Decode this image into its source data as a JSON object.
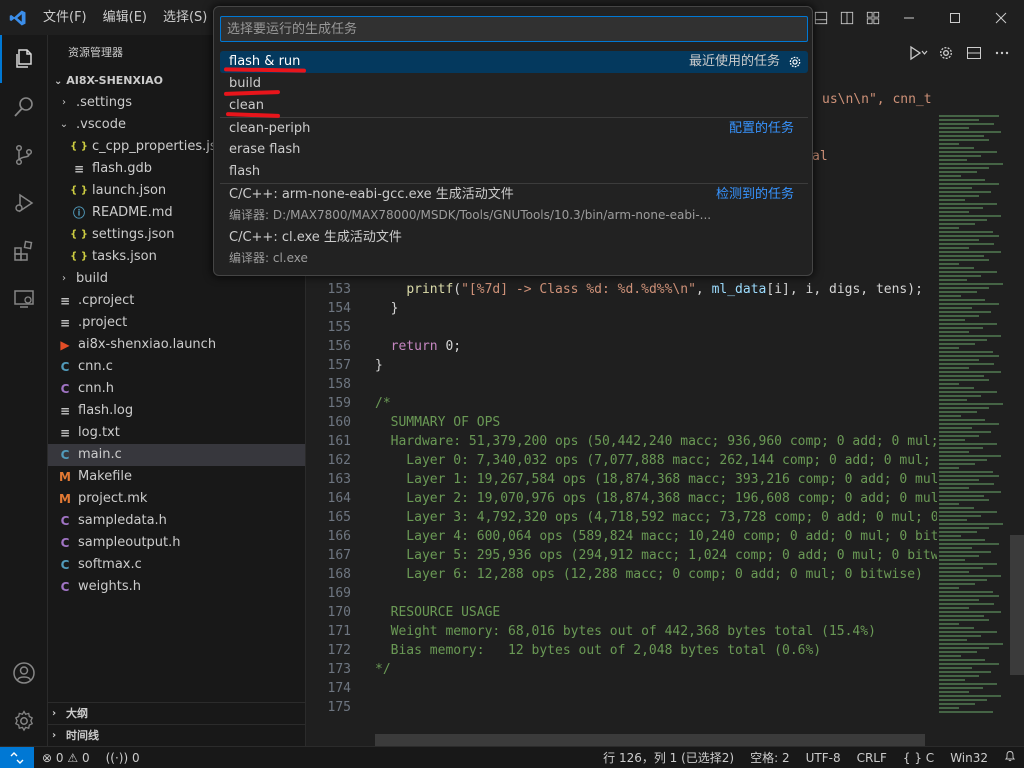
{
  "menu": {
    "file": "文件(F)",
    "edit": "编辑(E)",
    "selection": "选择(S)"
  },
  "sidebar": {
    "title": "资源管理器",
    "root": "AI8X-SHENXIAO",
    "items": [
      {
        "label": ".settings",
        "icon": "chevron-right",
        "depth": 1,
        "type": "folder"
      },
      {
        "label": ".vscode",
        "icon": "chevron-down",
        "depth": 1,
        "type": "folder"
      },
      {
        "label": "c_cpp_properties.json",
        "icon": "json",
        "depth": 2,
        "type": "json"
      },
      {
        "label": "flash.gdb",
        "icon": "gdb",
        "depth": 2,
        "type": "gdb"
      },
      {
        "label": "launch.json",
        "icon": "json",
        "depth": 2,
        "type": "json"
      },
      {
        "label": "README.md",
        "icon": "info",
        "depth": 2,
        "type": "info"
      },
      {
        "label": "settings.json",
        "icon": "json",
        "depth": 2,
        "type": "json"
      },
      {
        "label": "tasks.json",
        "icon": "json",
        "depth": 2,
        "type": "json"
      },
      {
        "label": "build",
        "icon": "chevron-right",
        "depth": 1,
        "type": "folder"
      },
      {
        "label": ".cproject",
        "icon": "lines",
        "depth": 1,
        "type": "lines"
      },
      {
        "label": ".project",
        "icon": "lines",
        "depth": 1,
        "type": "lines"
      },
      {
        "label": "ai8x-shenxiao.launch",
        "icon": "launch",
        "depth": 1,
        "type": "launch"
      },
      {
        "label": "cnn.c",
        "icon": "c",
        "depth": 1,
        "type": "c"
      },
      {
        "label": "cnn.h",
        "icon": "h",
        "depth": 1,
        "type": "h"
      },
      {
        "label": "flash.log",
        "icon": "lines",
        "depth": 1,
        "type": "lines"
      },
      {
        "label": "log.txt",
        "icon": "lines",
        "depth": 1,
        "type": "lines"
      },
      {
        "label": "main.c",
        "icon": "c",
        "depth": 1,
        "type": "c",
        "selected": true
      },
      {
        "label": "Makefile",
        "icon": "m",
        "depth": 1,
        "type": "m"
      },
      {
        "label": "project.mk",
        "icon": "m",
        "depth": 1,
        "type": "m"
      },
      {
        "label": "sampledata.h",
        "icon": "h",
        "depth": 1,
        "type": "h"
      },
      {
        "label": "sampleoutput.h",
        "icon": "h",
        "depth": 1,
        "type": "h"
      },
      {
        "label": "softmax.c",
        "icon": "c",
        "depth": 1,
        "type": "c"
      },
      {
        "label": "weights.h",
        "icon": "h",
        "depth": 1,
        "type": "h"
      }
    ],
    "outline": "大纲",
    "timeline": "时间线"
  },
  "palette": {
    "placeholder": "选择要运行的生成任务",
    "recent_label": "最近使用的任务",
    "configured_label": "配置的任务",
    "detected_label": "检测到的任务",
    "items": {
      "flash_run": "flash & run",
      "build": "build",
      "clean": "clean",
      "clean_periph": "clean-periph",
      "erase_flash": "erase flash",
      "flash": "flash",
      "gcc_title": "C/C++: arm-none-eabi-gcc.exe 生成活动文件",
      "gcc_desc": "编译器: D:/MAX7800/MAX78000/MSDK/Tools/GNUTools/10.3/bin/arm-none-eabi-...",
      "cl_title": "C/C++: cl.exe 生成活动文件",
      "cl_desc": "编译器: cl.exe"
    }
  },
  "editor": {
    "partial_top": "us\\n\\n\", cnn_t",
    "partial_al": "al",
    "lines": [
      {
        "n": "153",
        "segments": [
          [
            "p",
            "    "
          ],
          [
            "f",
            "printf"
          ],
          [
            "p",
            "("
          ],
          [
            "s",
            "\"[%7d] -> Class %d: %d.%d%%\\n\""
          ],
          [
            "p",
            ", "
          ],
          [
            "v",
            "ml_data"
          ],
          [
            "p",
            "[i], i, digs, tens);"
          ]
        ]
      },
      {
        "n": "154",
        "segments": [
          [
            "p",
            "  }"
          ]
        ]
      },
      {
        "n": "155",
        "segments": [
          [
            "p",
            ""
          ]
        ]
      },
      {
        "n": "156",
        "segments": [
          [
            "p",
            "  "
          ],
          [
            "k",
            "return"
          ],
          [
            "p",
            " 0;"
          ]
        ]
      },
      {
        "n": "157",
        "segments": [
          [
            "p",
            "}"
          ]
        ]
      },
      {
        "n": "158",
        "segments": [
          [
            "p",
            ""
          ]
        ]
      },
      {
        "n": "159",
        "segments": [
          [
            "cm",
            "/*"
          ]
        ]
      },
      {
        "n": "160",
        "segments": [
          [
            "cm",
            "  SUMMARY OF OPS"
          ]
        ]
      },
      {
        "n": "161",
        "segments": [
          [
            "cm",
            "  Hardware: 51,379,200 ops (50,442,240 macc; 936,960 comp; 0 add; 0 mul;"
          ]
        ]
      },
      {
        "n": "162",
        "segments": [
          [
            "cm",
            "    Layer 0: 7,340,032 ops (7,077,888 macc; 262,144 comp; 0 add; 0 mul;"
          ]
        ]
      },
      {
        "n": "163",
        "segments": [
          [
            "cm",
            "    Layer 1: 19,267,584 ops (18,874,368 macc; 393,216 comp; 0 add; 0 mul"
          ]
        ]
      },
      {
        "n": "164",
        "segments": [
          [
            "cm",
            "    Layer 2: 19,070,976 ops (18,874,368 macc; 196,608 comp; 0 add; 0 mul"
          ]
        ]
      },
      {
        "n": "165",
        "segments": [
          [
            "cm",
            "    Layer 3: 4,792,320 ops (4,718,592 macc; 73,728 comp; 0 add; 0 mul; 0"
          ]
        ]
      },
      {
        "n": "166",
        "segments": [
          [
            "cm",
            "    Layer 4: 600,064 ops (589,824 macc; 10,240 comp; 0 add; 0 mul; 0 bit"
          ]
        ]
      },
      {
        "n": "167",
        "segments": [
          [
            "cm",
            "    Layer 5: 295,936 ops (294,912 macc; 1,024 comp; 0 add; 0 mul; 0 bitw"
          ]
        ]
      },
      {
        "n": "168",
        "segments": [
          [
            "cm",
            "    Layer 6: 12,288 ops (12,288 macc; 0 comp; 0 add; 0 mul; 0 bitwise)"
          ]
        ]
      },
      {
        "n": "169",
        "segments": [
          [
            "p",
            ""
          ]
        ]
      },
      {
        "n": "170",
        "segments": [
          [
            "cm",
            "  RESOURCE USAGE"
          ]
        ]
      },
      {
        "n": "171",
        "segments": [
          [
            "cm",
            "  Weight memory: 68,016 bytes out of 442,368 bytes total (15.4%)"
          ]
        ]
      },
      {
        "n": "172",
        "segments": [
          [
            "cm",
            "  Bias memory:   12 bytes out of 2,048 bytes total (0.6%)"
          ]
        ]
      },
      {
        "n": "173",
        "segments": [
          [
            "cm",
            "*/"
          ]
        ]
      },
      {
        "n": "174",
        "segments": [
          [
            "p",
            ""
          ]
        ]
      },
      {
        "n": "175",
        "segments": [
          [
            "p",
            ""
          ]
        ]
      }
    ]
  },
  "statusbar": {
    "errors": "0",
    "warnings": "0",
    "ports": "0",
    "position": "行 126，列 1 (已选择2)",
    "spaces": "空格: 2",
    "encoding": "UTF-8",
    "eol": "CRLF",
    "language": "{ } C",
    "platform": "Win32"
  },
  "colors": {
    "accent": "#0078d4",
    "selection": "#04395e",
    "link": "#3794ff",
    "annotation": "#e8151b"
  }
}
